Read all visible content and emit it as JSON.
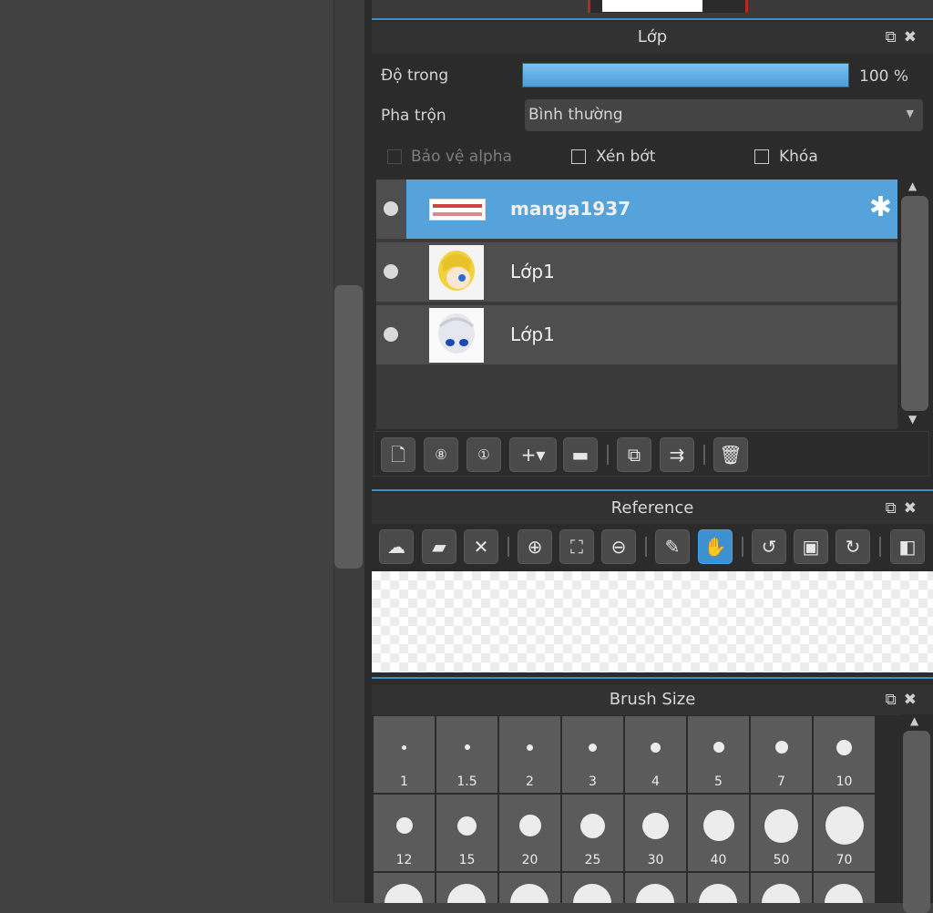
{
  "layer_panel": {
    "title": "Lớp",
    "opacity_label": "Độ trong",
    "opacity_value": "100 %",
    "opacity_level": 1.0,
    "blend_label": "Pha trộn",
    "blend_value": "Bình thường",
    "protect_alpha_label": "Bảo vệ alpha",
    "clipping_label": "Xén bớt",
    "lock_label": "Khóa",
    "layers": [
      {
        "name": "manga1937",
        "selected": true
      },
      {
        "name": "Lớp1",
        "selected": false
      },
      {
        "name": "Lớp1",
        "selected": false
      }
    ]
  },
  "reference_panel": {
    "title": "Reference"
  },
  "brush_panel": {
    "title": "Brush Size",
    "sizes": [
      "1",
      "1.5",
      "2",
      "3",
      "4",
      "5",
      "7",
      "10",
      "12",
      "15",
      "20",
      "25",
      "30",
      "40",
      "50",
      "70"
    ]
  },
  "colors": {
    "accent": "#3e91d1",
    "selected_layer": "#56a3dc",
    "panel_bg": "#2b2b2b"
  }
}
